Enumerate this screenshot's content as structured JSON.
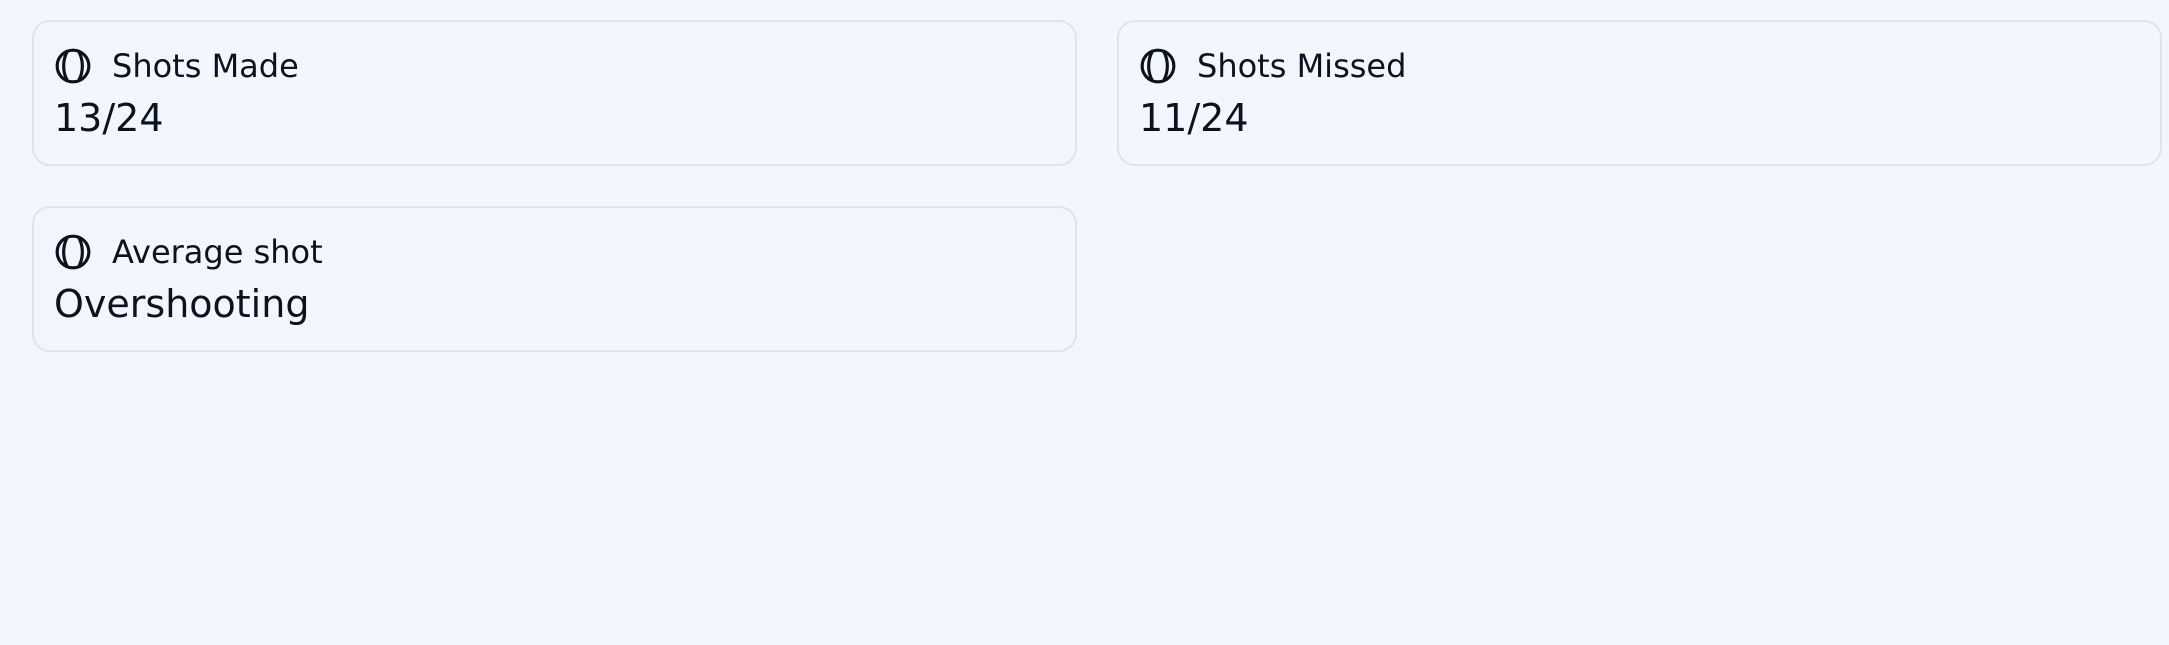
{
  "cards": [
    {
      "title": "Shots Made",
      "value": "13/24",
      "icon": "baseball-icon"
    },
    {
      "title": "Shots Missed",
      "value": "11/24",
      "icon": "baseball-icon"
    },
    {
      "title": "Average shot",
      "value": "Overshooting",
      "icon": "baseball-icon"
    }
  ],
  "colors": {
    "background": "#f2f7ff",
    "card_border": "#dde4ee",
    "text": "#0b1220"
  }
}
